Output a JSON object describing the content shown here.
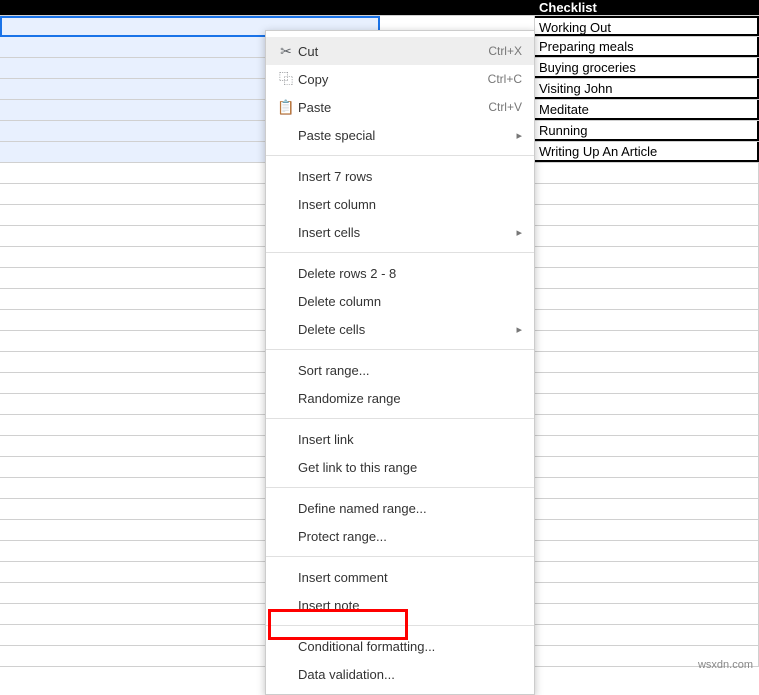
{
  "header": {
    "colA": "",
    "colB": "",
    "colC": "Checklist"
  },
  "checklist": [
    "Working Out",
    "Preparing meals",
    "Buying groceries",
    "Visiting John",
    "Meditate",
    "Running",
    "Writing Up An Article"
  ],
  "ctx": {
    "cut": "Cut",
    "cut_sc": "Ctrl+X",
    "copy": "Copy",
    "copy_sc": "Ctrl+C",
    "paste": "Paste",
    "paste_sc": "Ctrl+V",
    "paste_special": "Paste special",
    "insert_rows": "Insert 7 rows",
    "insert_column": "Insert column",
    "insert_cells": "Insert cells",
    "delete_rows": "Delete rows 2 - 8",
    "delete_column": "Delete column",
    "delete_cells": "Delete cells",
    "sort_range": "Sort range...",
    "randomize": "Randomize range",
    "insert_link": "Insert link",
    "get_link": "Get link to this range",
    "define_named": "Define named range...",
    "protect": "Protect range...",
    "insert_comment": "Insert comment",
    "insert_note": "Insert note",
    "cond_format": "Conditional formatting...",
    "data_validation": "Data validation..."
  },
  "attribution": "wsxdn.com",
  "icons": {
    "cut": "✂",
    "copy": "⿻",
    "paste": "📋",
    "submenu": "▸"
  }
}
